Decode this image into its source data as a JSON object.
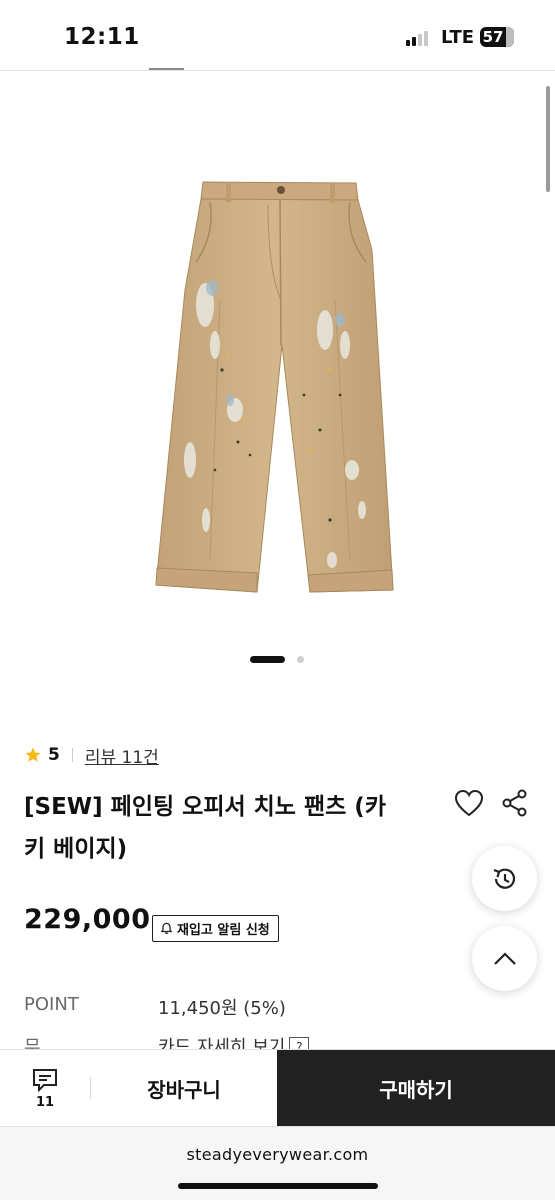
{
  "status_bar": {
    "time": "12:11",
    "network": "LTE",
    "battery": "57"
  },
  "product": {
    "rating": "5",
    "review_link": "리뷰 11건",
    "title_line1": "[SEW] 페인팅 오피서 치노 팬츠 (카",
    "title_line2": "키 베이지)",
    "price": "229,000",
    "restock_label": "재입고 알림 신청",
    "image_alt_color": "#cdae83"
  },
  "carousel": {
    "slides": 2,
    "active": 1
  },
  "info_rows": [
    {
      "label": "POINT",
      "value": "11,450원 (5%)"
    },
    {
      "label": "무이자 할부",
      "value": "카드 자세히 보기",
      "help": "?"
    }
  ],
  "bottom_bar": {
    "chat_count": "11",
    "cart_label": "장바구니",
    "buy_label": "구매하기"
  },
  "browser": {
    "url": "steadyeverywear.com"
  },
  "colors": {
    "accent": "#212121",
    "star": "#f5b915",
    "pants": "#cdae83"
  }
}
